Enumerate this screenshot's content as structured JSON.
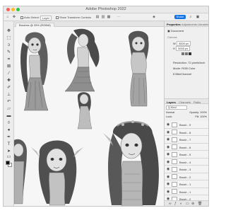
{
  "window": {
    "title": "Adobe Photoshop 2022"
  },
  "options_bar": {
    "auto_select_label": "Auto-Select:",
    "auto_select_target": "Layer",
    "transform_controls_label": "Show Transform Controls",
    "share_label": "Share"
  },
  "document": {
    "tab_label": "Brushes @ 33% (RGB/8)"
  },
  "properties_panel": {
    "tabs": [
      "Properties",
      "Adjustments",
      "Libraries"
    ],
    "section_label": "Document",
    "canvas_label": "Canvas",
    "width_label": "W",
    "width_value": "3000 px",
    "height_label": "H",
    "height_value": "3000 px",
    "resolution_label": "Resolution: 72 pixels/inch",
    "mode_label": "Mode:",
    "mode_value": "RGB Color",
    "depth_value": "8 Bits/Channel"
  },
  "layers_panel": {
    "tabs": [
      "Layers",
      "Channels",
      "Paths"
    ],
    "search_placeholder": "Q Kind",
    "blend_mode": "Normal",
    "opacity_label": "Opacity:",
    "opacity_value": "100%",
    "lock_label": "Lock:",
    "fill_label": "Fill:",
    "fill_value": "100%",
    "layers": [
      {
        "name": "Brush - 9"
      },
      {
        "name": "Brush - 8"
      },
      {
        "name": "Brush - 7"
      },
      {
        "name": "Brush - 6"
      },
      {
        "name": "Brush - 5"
      },
      {
        "name": "Brush - 4"
      },
      {
        "name": "Brush - 3"
      },
      {
        "name": "Brush - 2"
      },
      {
        "name": "Brush - 1"
      },
      {
        "name": "Brush - 1"
      },
      {
        "name": "Brush - 2"
      },
      {
        "name": "Brush - 1"
      }
    ]
  },
  "icons": {
    "eye": "eye-icon",
    "move": "move-tool-icon",
    "marquee": "marquee-tool-icon",
    "lasso": "lasso-tool-icon",
    "brush": "brush-tool-icon",
    "search": "search-icon"
  },
  "colors": {
    "accent": "#1473e6"
  }
}
